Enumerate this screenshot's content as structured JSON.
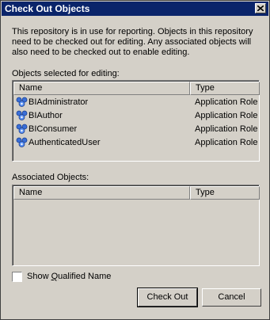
{
  "window": {
    "title": "Check Out Objects"
  },
  "description": "This repository is in use for reporting. Objects in this repository need to be checked out for editing. Any associated objects will also need to be checked out to enable editing.",
  "selected": {
    "label": "Objects selected for editing:",
    "columns": [
      "Name",
      "Type"
    ],
    "rows": [
      {
        "name": "BIAdministrator",
        "type": "Application Role",
        "icon": "application-role-icon"
      },
      {
        "name": "BIAuthor",
        "type": "Application Role",
        "icon": "application-role-icon"
      },
      {
        "name": "BIConsumer",
        "type": "Application Role",
        "icon": "application-role-icon"
      },
      {
        "name": "AuthenticatedUser",
        "type": "Application Role",
        "icon": "application-role-icon"
      }
    ]
  },
  "associated": {
    "label": "Associated Objects:",
    "columns": [
      "Name",
      "Type"
    ],
    "rows": []
  },
  "options": {
    "show_qualified_name": "Show Qualified Name",
    "show_qualified_name_checked": false
  },
  "buttons": {
    "check_out": "Check Out",
    "cancel": "Cancel"
  },
  "colors": {
    "titlebar": "#0a246a",
    "dialog": "#d4d0c8"
  }
}
